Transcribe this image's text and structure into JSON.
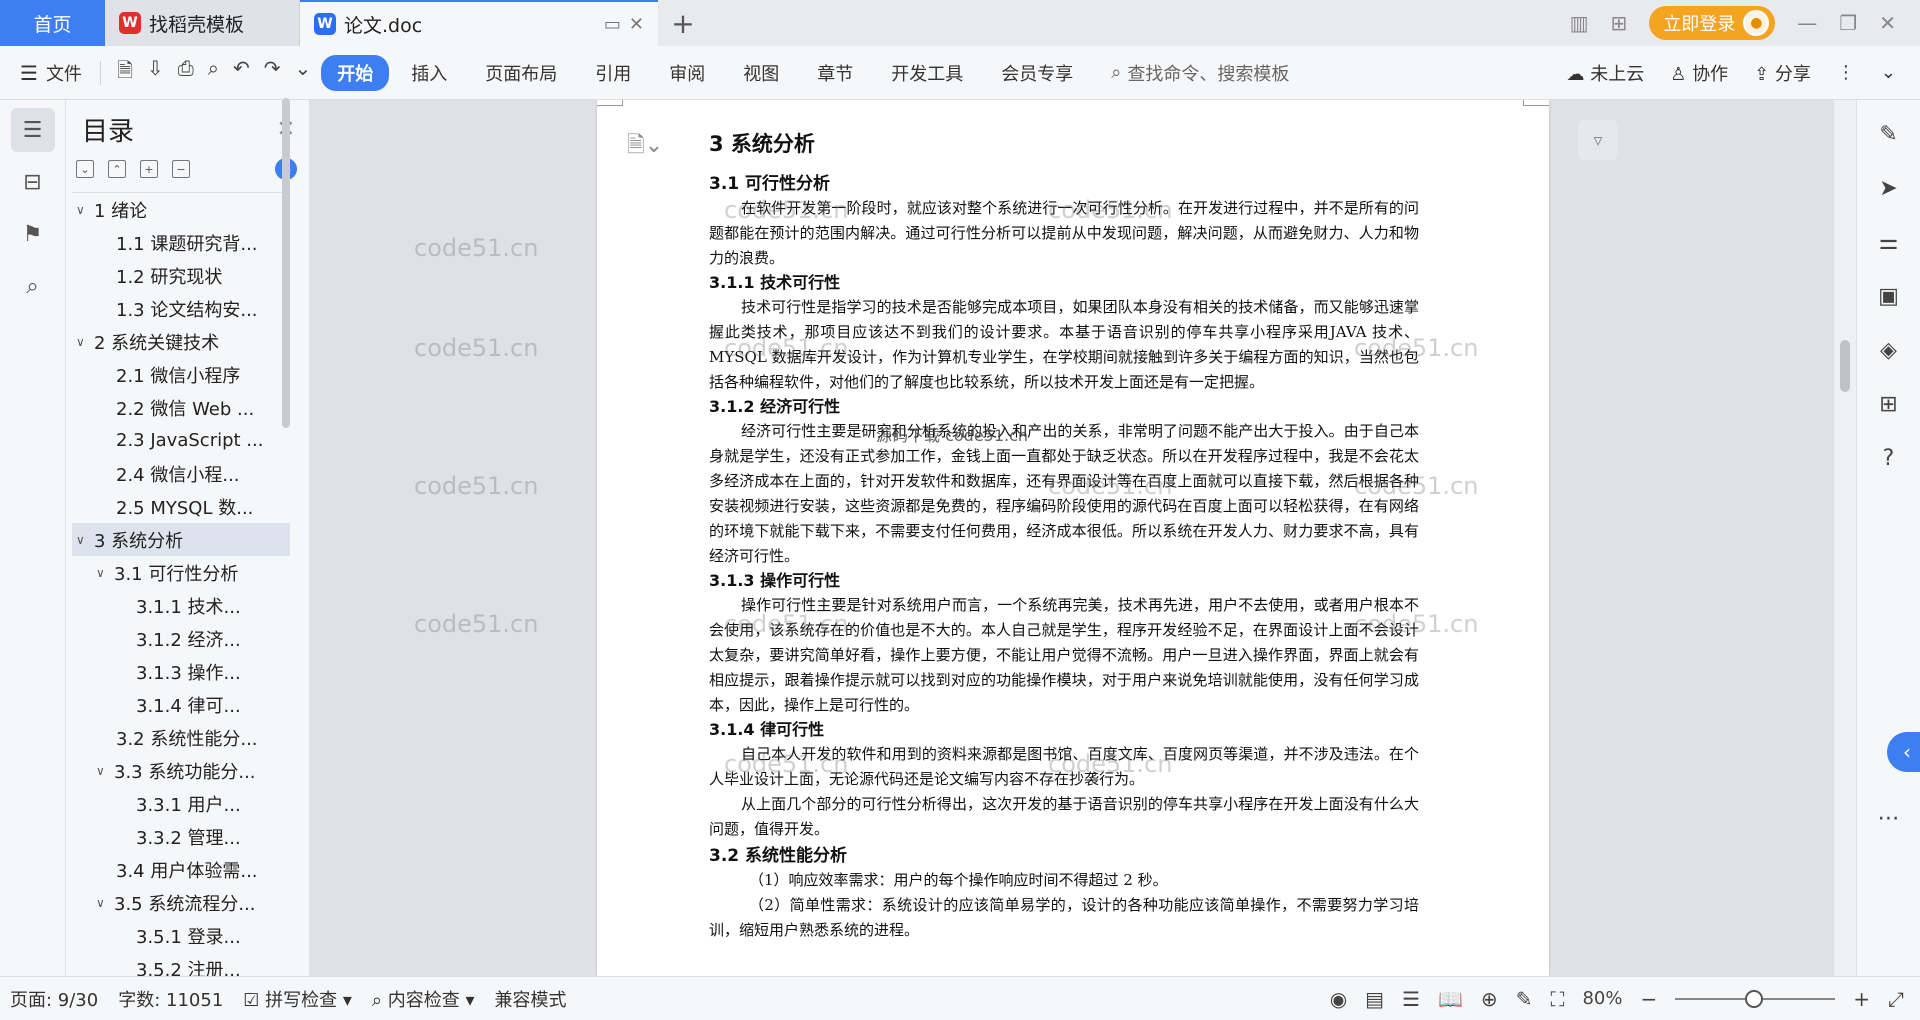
{
  "titlebar": {
    "home_tab": "首页",
    "tabs": [
      {
        "label": "找稻壳模板"
      },
      {
        "label": "论文.doc"
      }
    ],
    "add_tab": "+",
    "login_label": "立即登录"
  },
  "toolbar": {
    "file_label": "文件",
    "ribbon_tabs": [
      "开始",
      "插入",
      "页面布局",
      "引用",
      "审阅",
      "视图",
      "章节",
      "开发工具",
      "会员专享"
    ],
    "active_tab": "开始",
    "search_placeholder": "查找命令、搜索模板",
    "cloud_label": "未上云",
    "collab_label": "协作",
    "share_label": "分享"
  },
  "toc": {
    "title": "目录",
    "items": [
      {
        "label": "1 绪论",
        "level": 1,
        "expanded": true
      },
      {
        "label": "1.1 课题研究背...",
        "level": 2
      },
      {
        "label": "1.2 研究现状",
        "level": 2
      },
      {
        "label": "1.3 论文结构安...",
        "level": 2
      },
      {
        "label": "2 系统关键技术",
        "level": 1,
        "expanded": true
      },
      {
        "label": "2.1 微信小程序",
        "level": 2
      },
      {
        "label": "2.2 微信 Web ...",
        "level": 2
      },
      {
        "label": "2.3 JavaScript ...",
        "level": 2
      },
      {
        "label": "2.4 微信小程...",
        "level": 2
      },
      {
        "label": "2.5 MYSQL 数...",
        "level": 2
      },
      {
        "label": "3 系统分析",
        "level": 1,
        "expanded": true,
        "selected": true
      },
      {
        "label": "3.1 可行性分析",
        "level": 2,
        "expanded": true
      },
      {
        "label": "3.1.1 技术...",
        "level": 3
      },
      {
        "label": "3.1.2 经济...",
        "level": 3
      },
      {
        "label": "3.1.3 操作...",
        "level": 3
      },
      {
        "label": "3.1.4 律可...",
        "level": 3
      },
      {
        "label": "3.2 系统性能分...",
        "level": 2
      },
      {
        "label": "3.3 系统功能分...",
        "level": 2,
        "expanded": true
      },
      {
        "label": "3.3.1 用户...",
        "level": 3
      },
      {
        "label": "3.3.2 管理...",
        "level": 3
      },
      {
        "label": "3.4 用户体验需...",
        "level": 2
      },
      {
        "label": "3.5 系统流程分...",
        "level": 2,
        "expanded": true
      },
      {
        "label": "3.5.1 登录...",
        "level": 3
      },
      {
        "label": "3.5.2 注册...",
        "level": 3
      }
    ]
  },
  "document": {
    "h1": "3  系统分析",
    "s31": "3.1  可行性分析",
    "p31": "在软件开发第一阶段时，就应该对整个系统进行一次可行性分析。在开发进行过程中，并不是所有的问题都能在预计的范围内解决。通过可行性分析可以提前从中发现问题，解决问题，从而避免财力、人力和物力的浪费。",
    "s311": "3.1.1  技术可行性",
    "p311": "技术可行性是指学习的技术是否能够完成本项目，如果团队本身没有相关的技术储备，而又能够迅速掌握此类技术，那项目应该达不到我们的设计要求。本基于语音识别的停车共享小程序采用JAVA 技术、MYSQL 数据库开发设计，作为计算机专业学生，在学校期间就接触到许多关于编程方面的知识，当然也包括各种编程软件，对他们的了解度也比较系统，所以技术开发上面还是有一定把握。",
    "s312": "3.1.2  经济可行性",
    "p312": "经济可行性主要是研究和分析系统的投入和产出的关系，非常明了问题不能产出大于投入。由于自己本身就是学生，还没有正式参加工作，金钱上面一直都处于缺乏状态。所以在开发程序过程中，我是不会花太多经济成本在上面的，针对开发软件和数据库，还有界面设计等在百度上面就可以直接下载，然后根据各种安装视频进行安装，这些资源都是免费的，程序编码阶段使用的源代码在百度上面可以轻松获得，在有网络的环境下就能下载下来，不需要支付任何费用，经济成本很低。所以系统在开发人力、财力要求不高，具有经济可行性。",
    "s313": "3.1.3  操作可行性",
    "p313": "操作可行性主要是针对系统用户而言，一个系统再完美，技术再先进，用户不去使用，或者用户根本不会使用，该系统存在的价值也是不大的。本人自己就是学生，程序开发经验不足，在界面设计上面不会设计太复杂，要讲究简单好看，操作上要方便，不能让用户觉得不流畅。用户一旦进入操作界面，界面上就会有相应提示，跟着操作提示就可以找到对应的功能操作模块，对于用户来说免培训就能使用，没有任何学习成本，因此，操作上是可行性的。",
    "s314": "3.1.4  律可行性",
    "p314a": "自己本人开发的软件和用到的资料来源都是图书馆、百度文库、百度网页等渠道，并不涉及违法。在个人毕业设计上面，无论源代码还是论文编写内容不存在抄袭行为。",
    "p314b": "从上面几个部分的可行性分析得出，这次开发的基于语音识别的停车共享小程序在开发上面没有什么大问题，值得开发。",
    "s32": "3.2  系统性能分析",
    "p32a": "（1）响应效率需求：用户的每个操作响应时间不得超过 2 秒。",
    "p32b": "（2）简单性需求：系统设计的应该简单易学的，设计的各种功能应该简单操作，不需要努力学习培训，缩短用户熟悉系统的进程。"
  },
  "watermark": {
    "text": "code51.cn",
    "center_text": "源码下载 code51.cn"
  },
  "statusbar": {
    "page": "页面: 9/30",
    "words": "字数: 11051",
    "spellcheck": "拼写检查",
    "content_check": "内容检查",
    "compat": "兼容模式",
    "zoom": "80%"
  }
}
